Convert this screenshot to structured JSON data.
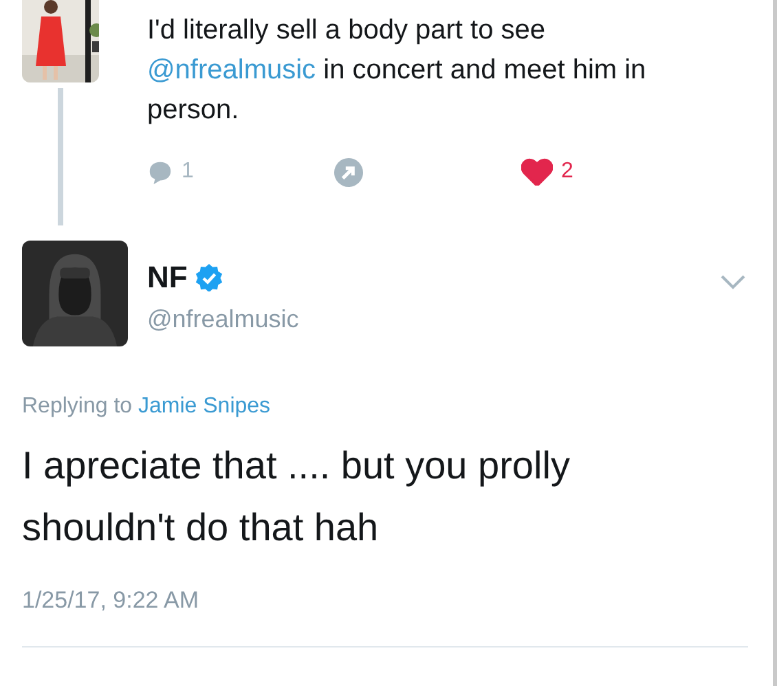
{
  "parent_tweet": {
    "text_parts": [
      {
        "kind": "text",
        "text": "I'd literally sell a body part to see "
      },
      {
        "kind": "mention",
        "text": "@nfrealmusic"
      },
      {
        "kind": "text",
        "text": " in concert and meet him in person."
      }
    ],
    "actions": [
      {
        "kind": "reply",
        "count": "1"
      },
      {
        "kind": "retweet"
      },
      {
        "kind": "like",
        "count": "2",
        "liked": true
      }
    ]
  },
  "reply_tweet": {
    "name": "NF",
    "verified": true,
    "handle": "@nfrealmusic",
    "replying_label": "Replying to",
    "replying_to": "Jamie Snipes",
    "text": "I apreciate that .... but you prolly shouldn't do that hah",
    "timestamp": "1/25/17, 9:22 AM"
  }
}
